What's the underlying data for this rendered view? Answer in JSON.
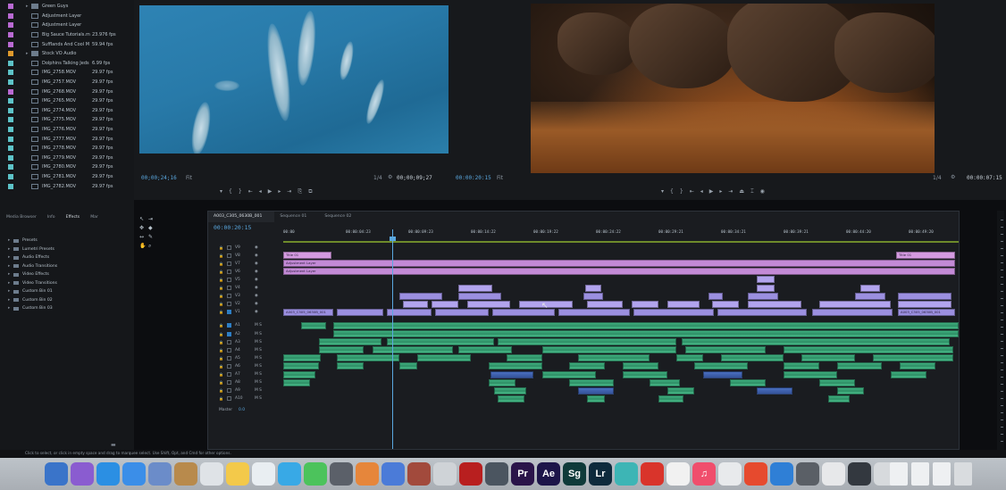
{
  "project_bin": {
    "items": [
      {
        "twisty": "▸",
        "folder": true,
        "name": "Green Guys",
        "fps": "",
        "chip": "#b96ad3"
      },
      {
        "twisty": "",
        "folder": false,
        "name": "Adjustment Layer",
        "fps": "",
        "chip": "#b96ad3"
      },
      {
        "twisty": "",
        "folder": false,
        "name": "Adjustment Layer",
        "fps": "",
        "chip": "#b96ad3"
      },
      {
        "twisty": "",
        "folder": false,
        "name": "Big Sauce Tutorials.m",
        "fps": "23.976 fps",
        "chip": "#b96ad3"
      },
      {
        "twisty": "",
        "folder": false,
        "name": "Sufflands And Cool M",
        "fps": "59.94 fps",
        "chip": "#b96ad3"
      },
      {
        "twisty": "▸",
        "folder": true,
        "name": "Stock VO Audio",
        "fps": "",
        "chip": "#e09a2c"
      },
      {
        "twisty": "",
        "folder": false,
        "name": "Dolphins Talking Jeds",
        "fps": "6.99 fps",
        "chip": "#5dc3c8"
      },
      {
        "twisty": "",
        "folder": false,
        "name": "IMG_2758.MOV",
        "fps": "29.97 fps",
        "chip": "#5dc3c8"
      },
      {
        "twisty": "",
        "folder": false,
        "name": "IMG_2757.MOV",
        "fps": "29.97 fps",
        "chip": "#5dc3c8"
      },
      {
        "twisty": "",
        "folder": false,
        "name": "IMG_2768.MOV",
        "fps": "29.97 fps",
        "chip": "#b96ad3"
      },
      {
        "twisty": "",
        "folder": false,
        "name": "IMG_2765.MOV",
        "fps": "29.97 fps",
        "chip": "#5dc3c8"
      },
      {
        "twisty": "",
        "folder": false,
        "name": "IMG_2774.MOV",
        "fps": "29.97 fps",
        "chip": "#5dc3c8"
      },
      {
        "twisty": "",
        "folder": false,
        "name": "IMG_2775.MOV",
        "fps": "29.97 fps",
        "chip": "#5dc3c8"
      },
      {
        "twisty": "",
        "folder": false,
        "name": "IMG_2776.MOV",
        "fps": "29.97 fps",
        "chip": "#5dc3c8"
      },
      {
        "twisty": "",
        "folder": false,
        "name": "IMG_2777.MOV",
        "fps": "29.97 fps",
        "chip": "#5dc3c8"
      },
      {
        "twisty": "",
        "folder": false,
        "name": "IMG_2778.MOV",
        "fps": "29.97 fps",
        "chip": "#5dc3c8"
      },
      {
        "twisty": "",
        "folder": false,
        "name": "IMG_2779.MOV",
        "fps": "29.97 fps",
        "chip": "#5dc3c8"
      },
      {
        "twisty": "",
        "folder": false,
        "name": "IMG_2780.MOV",
        "fps": "29.97 fps",
        "chip": "#5dc3c8"
      },
      {
        "twisty": "",
        "folder": false,
        "name": "IMG_2781.MOV",
        "fps": "29.97 fps",
        "chip": "#5dc3c8"
      },
      {
        "twisty": "",
        "folder": false,
        "name": "IMG_2782.MOV",
        "fps": "29.97 fps",
        "chip": "#5dc3c8"
      }
    ]
  },
  "source_monitor": {
    "timecode": "00;00;24;16",
    "fit": "Fit",
    "scale": "1/4",
    "duration": "00;00;09;27"
  },
  "program_monitor": {
    "timecode": "00:00:20:15",
    "fit": "Fit",
    "scale": "1/4",
    "duration": "00:00:07:15"
  },
  "effects_panel": {
    "tabs": [
      "Media Browser",
      "Info",
      "Effects",
      "Mar"
    ],
    "active_tab": "Effects",
    "items": [
      "Presets",
      "Lumetri Presets",
      "Audio Effects",
      "Audio Transitions",
      "Video Effects",
      "Video Transitions",
      "Custom Bin 01",
      "Custom Bin 02",
      "Custom Bin 03"
    ]
  },
  "timeline": {
    "tabs": [
      "A003_C305_0630B_001",
      "Sequence 01",
      "Sequence 02"
    ],
    "active_tab": "A003_C305_0630B_001",
    "timecode": "00:00:20:15",
    "ruler": [
      "00:00",
      "00:00:04:23",
      "00:00:09:23",
      "00:00:14:22",
      "00:00:19:22",
      "00:00:24:22",
      "00:00:29:21",
      "00:00:34:21",
      "00:00:39:21",
      "00:00:44:20",
      "00:00:49:20"
    ],
    "video_tracks": [
      "V9",
      "V8",
      "V7",
      "V6",
      "V5",
      "V4",
      "V3",
      "V2",
      "V1"
    ],
    "audio_tracks": [
      "A1",
      "A2",
      "A3",
      "A4",
      "A5",
      "A6",
      "A7",
      "A8",
      "A9",
      "A10"
    ],
    "master": {
      "label": "Master",
      "value": "0.0"
    },
    "clip_labels": {
      "title": "Title 01",
      "adjustment": "Adjustment Layer",
      "v1": "A003_C305_0630B_001"
    }
  },
  "status_bar": {
    "text": "Click to select, or click in empty space and drag to marquee select. Use Shift, Opt, and Cmd for other options."
  },
  "dock": {
    "apps": [
      {
        "label": "",
        "color": "#3a74c9"
      },
      {
        "label": "",
        "color": "#8a5cd0"
      },
      {
        "label": "",
        "color": "#2b8fe3"
      },
      {
        "label": "",
        "color": "#3b8ee8"
      },
      {
        "label": "",
        "color": "#6b8cc9"
      },
      {
        "label": "",
        "color": "#b88a4c"
      },
      {
        "label": "",
        "color": "#dfe3e7"
      },
      {
        "label": "",
        "color": "#f3c94a"
      },
      {
        "label": "",
        "color": "#e9eef2"
      },
      {
        "label": "",
        "color": "#38a9e6"
      },
      {
        "label": "",
        "color": "#4cc35c"
      },
      {
        "label": "",
        "color": "#5b6069"
      },
      {
        "label": "",
        "color": "#e6863b"
      },
      {
        "label": "",
        "color": "#4b7bd8"
      },
      {
        "label": "",
        "color": "#a24a3c"
      },
      {
        "label": "",
        "color": "#cfd3d7"
      },
      {
        "label": "",
        "color": "#b81f1f"
      },
      {
        "label": "",
        "color": "#4b5560"
      },
      {
        "label": "Pr",
        "color": "#2a1449"
      },
      {
        "label": "Ae",
        "color": "#1d1549"
      },
      {
        "label": "Sg",
        "color": "#0f3a3a"
      },
      {
        "label": "Lr",
        "color": "#0e2a3c"
      },
      {
        "label": "",
        "color": "#3db5b5"
      },
      {
        "label": "",
        "color": "#d9342b"
      },
      {
        "label": "",
        "color": "#f1f1f1"
      },
      {
        "label": "♫",
        "color": "#f04e6c"
      },
      {
        "label": "",
        "color": "#e8eaec"
      },
      {
        "label": "",
        "color": "#e64a2e"
      },
      {
        "label": "",
        "color": "#2f7fd6"
      },
      {
        "label": "",
        "color": "#5a5f66"
      },
      {
        "label": "",
        "color": "#e7e8ea"
      },
      {
        "label": "",
        "color": "#33383f"
      },
      {
        "label": "",
        "color": "#d7dadd"
      }
    ]
  }
}
